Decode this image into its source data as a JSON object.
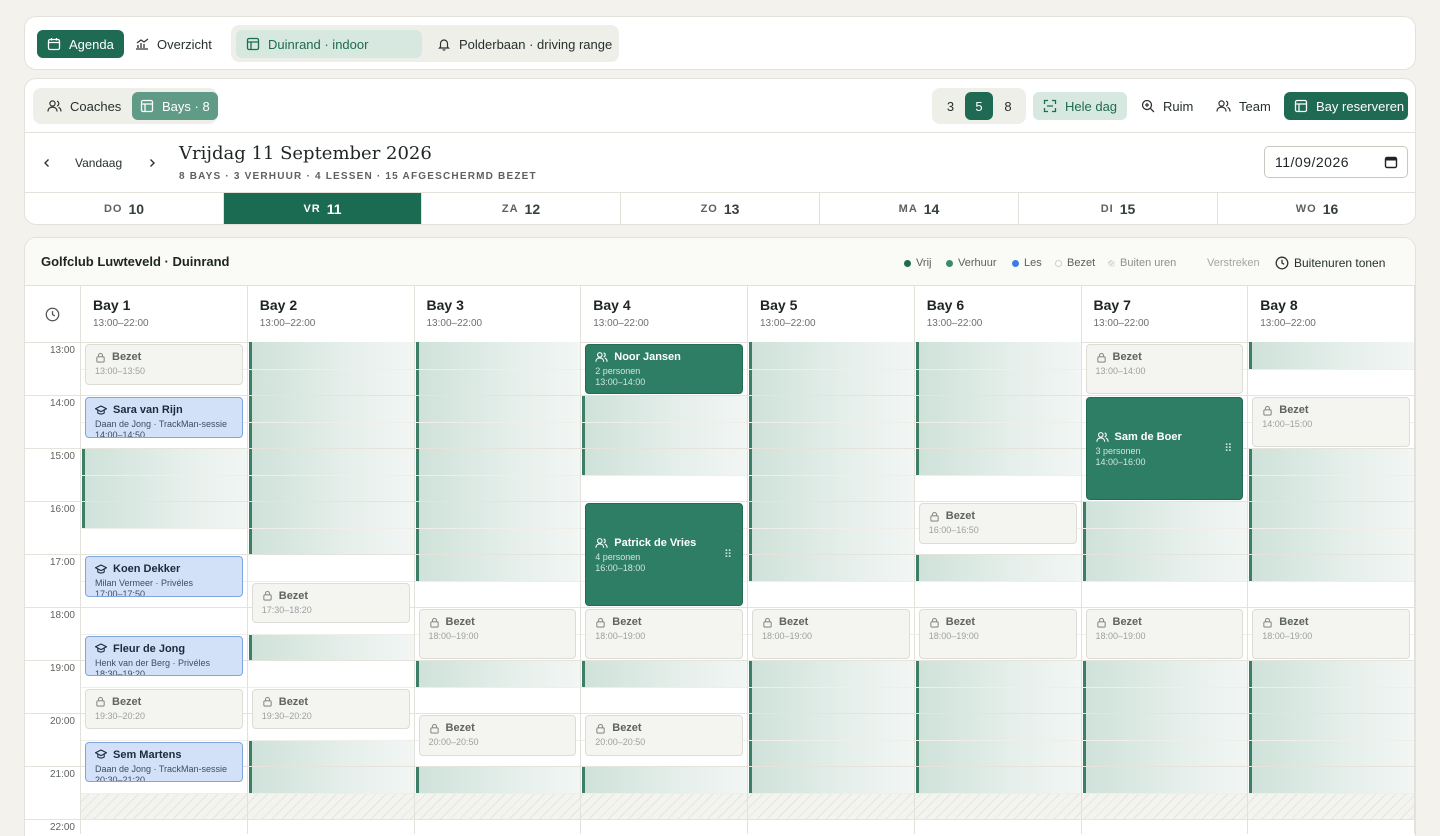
{
  "top_tabs": {
    "agenda": "Agenda",
    "overzicht": "Overzicht",
    "duinrand": "Duinrand · indoor",
    "polderbaan": "Polderbaan · driving range"
  },
  "toolbar": {
    "coaches": "Coaches",
    "bays": "Bays · 8",
    "density": [
      "3",
      "5",
      "8"
    ],
    "hele_dag": "Hele dag",
    "ruim": "Ruim",
    "team": "Team",
    "reserveren": "Bay reserveren"
  },
  "datebar": {
    "vandaag": "Vandaag",
    "title": "Vrijdag 11 September 2026",
    "summary": "8 BAYS · 3 VERHUUR · 4 LESSEN · 15 AFGESCHERMD BEZET",
    "date_value": "11/09/2026"
  },
  "days": [
    {
      "name": "DO",
      "num": "10"
    },
    {
      "name": "VR",
      "num": "11"
    },
    {
      "name": "ZA",
      "num": "12"
    },
    {
      "name": "ZO",
      "num": "13"
    },
    {
      "name": "MA",
      "num": "14"
    },
    {
      "name": "DI",
      "num": "15"
    },
    {
      "name": "WO",
      "num": "16"
    }
  ],
  "schedule": {
    "venue": "Golfclub Luwteveld · Duinrand",
    "legend": {
      "vrij": "Vrij",
      "verhuur": "Verhuur",
      "les": "Les",
      "bezet": "Bezet",
      "buiten": "Buiten uren",
      "verstreken": "Verstreken"
    },
    "buitenuren": "Buitenuren tonen",
    "colors": {
      "vrij": "#1f6a52",
      "verhuur": "#3c8a6e",
      "les": "#3b7de0",
      "bezet": "#f4f4f1",
      "accent": "#1b6a52"
    }
  },
  "bays": [
    {
      "name": "Bay 1",
      "hours": "13:00–22:00"
    },
    {
      "name": "Bay 2",
      "hours": "13:00–22:00"
    },
    {
      "name": "Bay 3",
      "hours": "13:00–22:00"
    },
    {
      "name": "Bay 4",
      "hours": "13:00–22:00"
    },
    {
      "name": "Bay 5",
      "hours": "13:00–22:00"
    },
    {
      "name": "Bay 6",
      "hours": "13:00–22:00"
    },
    {
      "name": "Bay 7",
      "hours": "13:00–22:00"
    },
    {
      "name": "Bay 8",
      "hours": "13:00–22:00"
    }
  ],
  "times": [
    "13:00",
    "14:00",
    "15:00",
    "16:00",
    "17:00",
    "18:00",
    "19:00",
    "20:00",
    "21:00",
    "22:00"
  ],
  "bezet_label": "Bezet",
  "free_slots": [
    {
      "bay": 1,
      "from": 15.0,
      "to": 16.5
    },
    {
      "bay": 2,
      "from": 13.0,
      "to": 17.0
    },
    {
      "bay": 2,
      "from": 18.5,
      "to": 19.0
    },
    {
      "bay": 2,
      "from": 20.5,
      "to": 21.5
    },
    {
      "bay": 3,
      "from": 13.0,
      "to": 17.5
    },
    {
      "bay": 3,
      "from": 19.0,
      "to": 19.5
    },
    {
      "bay": 3,
      "from": 21.0,
      "to": 21.5
    },
    {
      "bay": 4,
      "from": 14.0,
      "to": 15.5
    },
    {
      "bay": 4,
      "from": 19.0,
      "to": 19.5
    },
    {
      "bay": 4,
      "from": 21.0,
      "to": 21.5
    },
    {
      "bay": 5,
      "from": 13.0,
      "to": 17.5
    },
    {
      "bay": 5,
      "from": 19.0,
      "to": 21.5
    },
    {
      "bay": 6,
      "from": 13.0,
      "to": 15.5
    },
    {
      "bay": 6,
      "from": 17.0,
      "to": 17.5
    },
    {
      "bay": 6,
      "from": 19.0,
      "to": 21.5
    },
    {
      "bay": 7,
      "from": 16.0,
      "to": 17.5
    },
    {
      "bay": 7,
      "from": 19.0,
      "to": 21.5
    },
    {
      "bay": 8,
      "from": 13.0,
      "to": 13.5
    },
    {
      "bay": 8,
      "from": 15.0,
      "to": 17.5
    },
    {
      "bay": 8,
      "from": 19.0,
      "to": 21.5
    }
  ],
  "blocks": [
    {
      "bay": 1,
      "from": 13.0,
      "to": 13.83,
      "type": "bezet",
      "title": "Bezet",
      "time": "13:00–13:50"
    },
    {
      "bay": 1,
      "from": 14.0,
      "to": 14.83,
      "type": "les",
      "title": "Sara van Rijn",
      "sub": "Daan de Jong · TrackMan-sessie",
      "time": "14:00–14:50"
    },
    {
      "bay": 1,
      "from": 17.0,
      "to": 17.83,
      "type": "les",
      "title": "Koen Dekker",
      "sub": "Milan Vermeer · Privéles",
      "time": "17:00–17:50"
    },
    {
      "bay": 1,
      "from": 18.5,
      "to": 19.33,
      "type": "les",
      "title": "Fleur de Jong",
      "sub": "Henk van der Berg · Privéles",
      "time": "18:30–19:20"
    },
    {
      "bay": 1,
      "from": 19.5,
      "to": 20.33,
      "type": "bezet",
      "title": "Bezet",
      "time": "19:30–20:20"
    },
    {
      "bay": 1,
      "from": 20.5,
      "to": 21.33,
      "type": "les",
      "title": "Sem Martens",
      "sub": "Daan de Jong · TrackMan-sessie",
      "time": "20:30–21:20"
    },
    {
      "bay": 2,
      "from": 17.5,
      "to": 18.33,
      "type": "bezet",
      "title": "Bezet",
      "time": "17:30–18:20"
    },
    {
      "bay": 2,
      "from": 19.5,
      "to": 20.33,
      "type": "bezet",
      "title": "Bezet",
      "time": "19:30–20:20"
    },
    {
      "bay": 3,
      "from": 18.0,
      "to": 19.0,
      "type": "bezet",
      "title": "Bezet",
      "time": "18:00–19:00"
    },
    {
      "bay": 3,
      "from": 20.0,
      "to": 20.83,
      "type": "bezet",
      "title": "Bezet",
      "time": "20:00–20:50"
    },
    {
      "bay": 4,
      "from": 13.0,
      "to": 14.0,
      "type": "verhuur",
      "title": "Noor Jansen",
      "sub": "2 personen",
      "time": "13:00–14:00"
    },
    {
      "bay": 4,
      "from": 16.0,
      "to": 18.0,
      "type": "verhuur",
      "title": "Patrick de Vries",
      "sub": "4 personen",
      "time": "16:00–18:00",
      "grip": true
    },
    {
      "bay": 4,
      "from": 18.0,
      "to": 19.0,
      "type": "bezet",
      "title": "Bezet",
      "time": "18:00–19:00"
    },
    {
      "bay": 4,
      "from": 20.0,
      "to": 20.83,
      "type": "bezet",
      "title": "Bezet",
      "time": "20:00–20:50"
    },
    {
      "bay": 5,
      "from": 18.0,
      "to": 19.0,
      "type": "bezet",
      "title": "Bezet",
      "time": "18:00–19:00"
    },
    {
      "bay": 6,
      "from": 16.0,
      "to": 16.83,
      "type": "bezet",
      "title": "Bezet",
      "time": "16:00–16:50"
    },
    {
      "bay": 6,
      "from": 18.0,
      "to": 19.0,
      "type": "bezet",
      "title": "Bezet",
      "time": "18:00–19:00"
    },
    {
      "bay": 7,
      "from": 13.0,
      "to": 14.0,
      "type": "bezet",
      "title": "Bezet",
      "time": "13:00–14:00"
    },
    {
      "bay": 7,
      "from": 14.0,
      "to": 16.0,
      "type": "verhuur",
      "title": "Sam de Boer",
      "sub": "3 personen",
      "time": "14:00–16:00",
      "grip": true
    },
    {
      "bay": 7,
      "from": 18.0,
      "to": 19.0,
      "type": "bezet",
      "title": "Bezet",
      "time": "18:00–19:00"
    },
    {
      "bay": 8,
      "from": 14.0,
      "to": 15.0,
      "type": "bezet",
      "title": "Bezet",
      "time": "14:00–15:00"
    },
    {
      "bay": 8,
      "from": 18.0,
      "to": 19.0,
      "type": "bezet",
      "title": "Bezet",
      "time": "18:00–19:00"
    }
  ]
}
